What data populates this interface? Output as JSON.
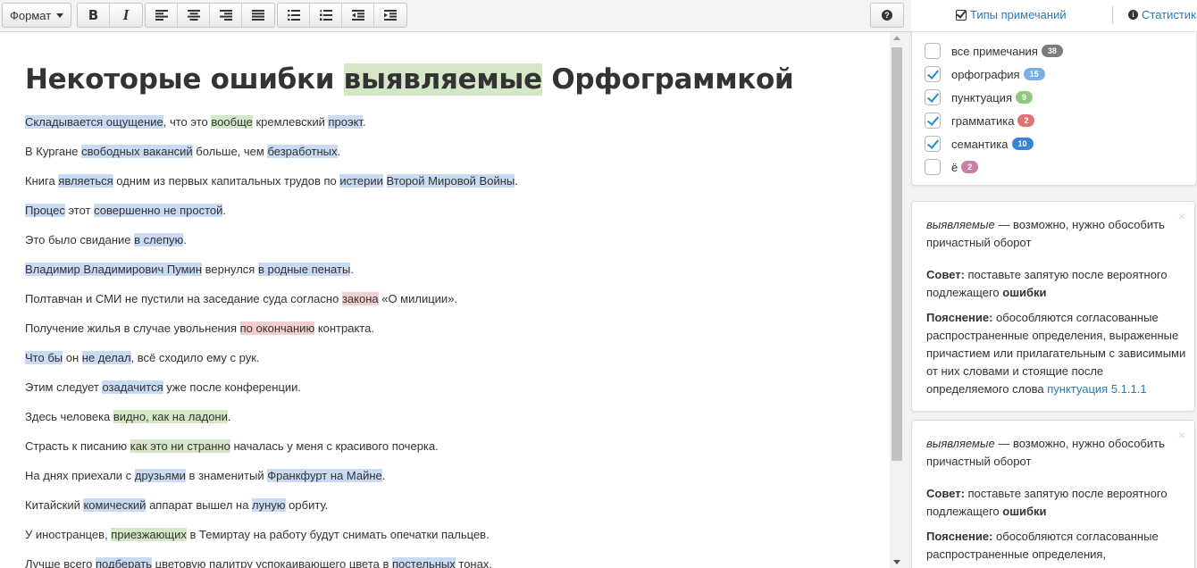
{
  "toolbar": {
    "format_label": "Формат",
    "bold_glyph": "B",
    "italic_glyph": "I",
    "help_glyph": "?"
  },
  "right_header": {
    "note_types_label": "Типы примечаний",
    "stats_label": "Статистика",
    "info_glyph": "i"
  },
  "document": {
    "title_parts": [
      "Некоторые ошибки ",
      "выявляемые",
      " Орфограммкой"
    ],
    "lines": [
      [
        {
          "t": "Складывается ощущение",
          "m": "blue"
        },
        {
          "t": ", что это "
        },
        {
          "t": "вообще",
          "m": "green"
        },
        {
          "t": " кремлевский "
        },
        {
          "t": "проэкт",
          "m": "blue"
        },
        {
          "t": "."
        }
      ],
      [
        {
          "t": "В Кургане "
        },
        {
          "t": "свободных вакансий",
          "m": "blue"
        },
        {
          "t": " больше, чем "
        },
        {
          "t": "безработных",
          "m": "blue"
        },
        {
          "t": "."
        }
      ],
      [
        {
          "t": "Книга "
        },
        {
          "t": "являеться",
          "m": "blue"
        },
        {
          "t": " одним из первых капитальных трудов по "
        },
        {
          "t": "истерии",
          "m": "blue"
        },
        {
          "t": " "
        },
        {
          "t": "Второй Мировой Войны",
          "m": "blue"
        },
        {
          "t": "."
        }
      ],
      [
        {
          "t": "Процес",
          "m": "blue"
        },
        {
          "t": " этот "
        },
        {
          "t": "совершенно не простой",
          "m": "blue"
        },
        {
          "t": "."
        }
      ],
      [
        {
          "t": "Это было свидание "
        },
        {
          "t": "в слепую",
          "m": "blue"
        },
        {
          "t": "."
        }
      ],
      [
        {
          "t": "Владимир Владимирович Пумин",
          "m": "blue"
        },
        {
          "t": " вернулся "
        },
        {
          "t": "в родные пенаты",
          "m": "blue"
        },
        {
          "t": "."
        }
      ],
      [
        {
          "t": "Полтавчан и СМИ не пустили на заседание суда согласно "
        },
        {
          "t": "закона",
          "m": "red"
        },
        {
          "t": " «О милиции»."
        }
      ],
      [
        {
          "t": "Получение жилья в случае увольнения "
        },
        {
          "t": "по окончанию",
          "m": "red"
        },
        {
          "t": " контракта."
        }
      ],
      [
        {
          "t": "Что бы",
          "m": "blue"
        },
        {
          "t": " он "
        },
        {
          "t": "не делал",
          "m": "blue"
        },
        {
          "t": ", всё сходило ему с рук."
        }
      ],
      [
        {
          "t": "Этим следует "
        },
        {
          "t": "озадачится",
          "m": "blue"
        },
        {
          "t": " уже после конференции."
        }
      ],
      [
        {
          "t": "Здесь человека "
        },
        {
          "t": "видно, как на ладони",
          "m": "green"
        },
        {
          "t": "."
        }
      ],
      [
        {
          "t": "Страсть к писанию "
        },
        {
          "t": "как это ни странно",
          "m": "green"
        },
        {
          "t": " началась у меня с красивого почерка."
        }
      ],
      [
        {
          "t": "На днях приехали с "
        },
        {
          "t": "друзьями",
          "m": "blue"
        },
        {
          "t": " в знаменитый "
        },
        {
          "t": "Франкфурт на Майне",
          "m": "blue"
        },
        {
          "t": "."
        }
      ],
      [
        {
          "t": "Китайский "
        },
        {
          "t": "комический",
          "m": "blue"
        },
        {
          "t": " аппарат вышел на "
        },
        {
          "t": "луную",
          "m": "blue"
        },
        {
          "t": " орбиту."
        }
      ],
      [
        {
          "t": "У иностранцев, "
        },
        {
          "t": "приезжающих",
          "m": "green"
        },
        {
          "t": " в Темиртау на работу будут снимать опечатки пальцев."
        }
      ],
      [
        {
          "t": "Лучше всего "
        },
        {
          "t": "подберать",
          "m": "blue"
        },
        {
          "t": " цветовую палитру успокаивающего цвета в "
        },
        {
          "t": "постельных",
          "m": "blue"
        },
        {
          "t": " тонах."
        }
      ]
    ]
  },
  "filters": [
    {
      "label": "все примечания",
      "count": "38",
      "checked": false,
      "color": "#7b7b7b"
    },
    {
      "label": "орфография",
      "count": "15",
      "checked": true,
      "color": "#7ab1e2"
    },
    {
      "label": "пунктуация",
      "count": "9",
      "checked": true,
      "color": "#93c67f"
    },
    {
      "label": "грамматика",
      "count": "2",
      "checked": true,
      "color": "#e17272"
    },
    {
      "label": "семантика",
      "count": "10",
      "checked": true,
      "color": "#3b83d6"
    },
    {
      "label": "ё",
      "count": "2",
      "checked": false,
      "color": "#c97fa6"
    }
  ],
  "cards": [
    {
      "word": "выявляемые",
      "desc_rest": " — возможно, нужно обособить причастный оборот",
      "advice_label": "Совет:",
      "advice_text": " поставьте запятую после вероятного подлежащего ",
      "advice_bold": "ошибки",
      "expl_label": "Пояснение:",
      "expl_text": " обособляются согласованные распространенные определения, выраженные причастием или прилагательным с зависимыми от них словами и стоящие после определяемого слова ",
      "expl_link": "пунктуация 5.1.1.1",
      "close_glyph": "×"
    },
    {
      "word": "выявляемые",
      "desc_rest": " — возможно, нужно обособить причастный оборот",
      "advice_label": "Совет:",
      "advice_text": " поставьте запятую после вероятного подлежащего ",
      "advice_bold": "ошибки",
      "expl_label": "Пояснение:",
      "expl_text": " обособляются согласованные распространенные определения,",
      "expl_link": "",
      "close_glyph": "×"
    }
  ],
  "colors": {
    "accent": "#2a7ab8",
    "mark_blue": "#c9dbf2",
    "mark_green": "#d4e8c8",
    "mark_red": "#f3cece"
  }
}
